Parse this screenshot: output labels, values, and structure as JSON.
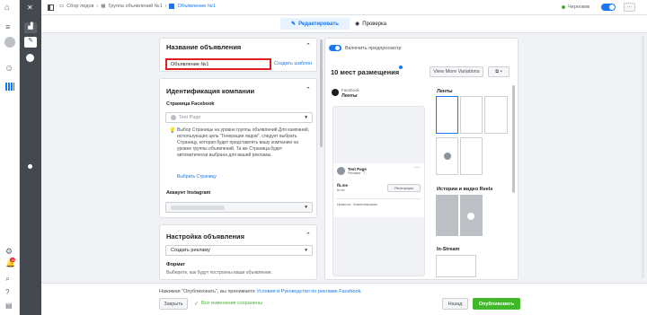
{
  "colors": {
    "accent": "#1877f2",
    "publish_green": "#42b72a",
    "sidebar_dark": "#444950",
    "highlight_red": "#e02020"
  },
  "breadcrumb": {
    "campaign": "Сбор лидов",
    "adset": "Группа объявлений №1",
    "ad": "Объявление №1"
  },
  "status": {
    "label": "Черновик"
  },
  "modes": {
    "edit": "Редактировать",
    "review": "Проверка"
  },
  "ad_name": {
    "title": "Название объявления",
    "value": "Объявление №1",
    "template_link": "Создать шаблон"
  },
  "identity": {
    "title": "Идентификация компании",
    "page_label": "Страница Facebook",
    "page_value": "Test Page",
    "info_text": "Выбор Страницы на уровне группы объявлений Для кампаний, использующих цель \"Генерация лидов\", следует выбрать Страницу, которая будет представлять вашу компанию на уровне группы объявлений. Та же Страница будет автоматически выбрана для вашей рекламы.",
    "info_link": "Выбрать Страницу",
    "instagram_label": "Аккаунт Instagram"
  },
  "ad_setup": {
    "title": "Настройка объявления",
    "create_value": "Создать рекламу",
    "format_label": "Формат",
    "format_desc": "Выберите, как будут построены ваши объявления."
  },
  "preview": {
    "toggle_label": "Включить предпросмотр",
    "placements_count": "10 мест размещения",
    "view_more": "View More Variations",
    "fb_label": "Facebook",
    "feed_label": "Ленты",
    "post_page": "Test Page",
    "post_meta": "Реклама · ⓘ",
    "post_domain": "fb.me",
    "post_subdomain": "fb.me",
    "signup_btn": "Регистрация",
    "like": "Нравится",
    "comment": "Комментировать",
    "sections": [
      "Ленты",
      "Истории и видео Reels",
      "In-Stream"
    ]
  },
  "footer": {
    "terms_prefix": "Нажимая \"Опубликовать\", вы принимаете ",
    "terms_link": "Условия и Руководство по рекламе Facebook",
    "terms_suffix": ".",
    "close": "Закрыть",
    "saved": "Все изменения сохранены",
    "back": "Назад",
    "publish": "Опубликовать"
  },
  "icons": [
    "home-icon",
    "menu-icon",
    "avatar-icon",
    "emoji-icon",
    "grid-icon",
    "close-icon",
    "chart-icon",
    "pencil-icon",
    "clock-icon",
    "settings-icon",
    "notifications-icon",
    "search-icon",
    "help-icon",
    "report-icon"
  ],
  "notification_count": "15"
}
